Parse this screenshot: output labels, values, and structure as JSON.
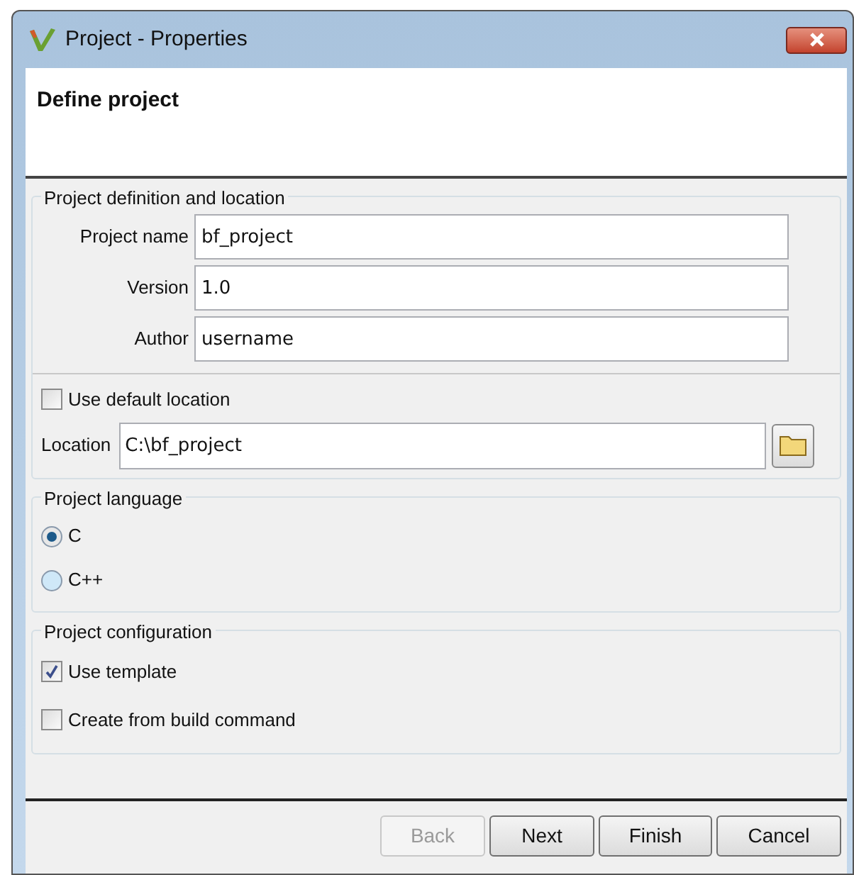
{
  "window": {
    "title": "Project - Properties"
  },
  "header": {
    "title": "Define project"
  },
  "definition_group": {
    "title": "Project definition and location",
    "fields": [
      {
        "label": "Project name",
        "value": "bf_project"
      },
      {
        "label": "Version",
        "value": "1.0"
      },
      {
        "label": "Author",
        "value": "username"
      }
    ],
    "use_default_location": {
      "label": "Use default location",
      "checked": false
    },
    "location": {
      "label": "Location",
      "value": "C:\\bf_project"
    }
  },
  "language_group": {
    "title": "Project language",
    "options": [
      {
        "label": "C",
        "selected": true
      },
      {
        "label": "C++",
        "selected": false
      }
    ]
  },
  "configuration_group": {
    "title": "Project configuration",
    "options": [
      {
        "label": "Use template",
        "checked": true
      },
      {
        "label": "Create from build command",
        "checked": false
      }
    ]
  },
  "buttons": [
    {
      "label": "Back",
      "disabled": true
    },
    {
      "label": "Next",
      "disabled": false
    },
    {
      "label": "Finish",
      "disabled": false
    },
    {
      "label": "Cancel",
      "disabled": false
    }
  ]
}
